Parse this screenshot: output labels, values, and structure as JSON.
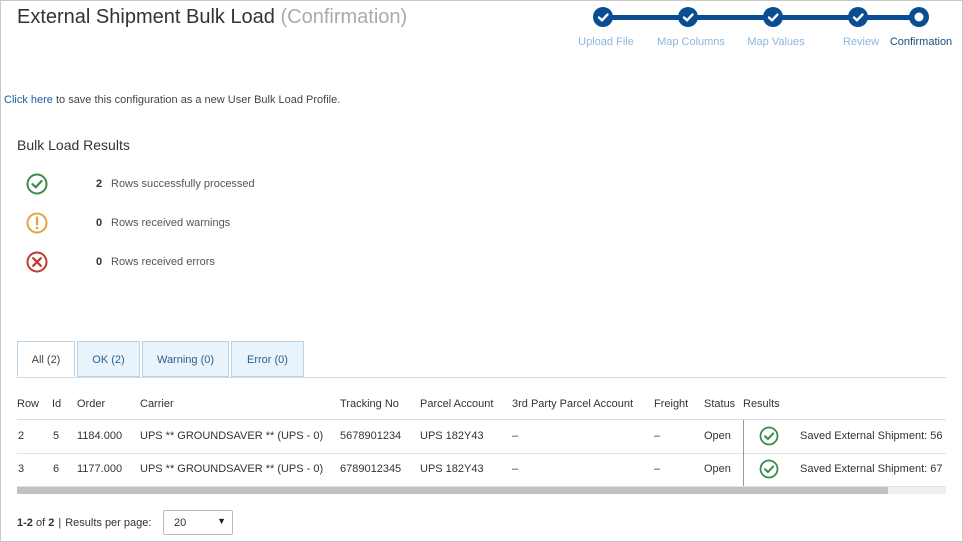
{
  "page": {
    "title": "External Shipment Bulk Load",
    "subtitle": "(Confirmation)"
  },
  "wizard": {
    "steps": [
      {
        "label": "Upload File",
        "state": "done"
      },
      {
        "label": "Map Columns",
        "state": "done"
      },
      {
        "label": "Map Values",
        "state": "done"
      },
      {
        "label": "Review",
        "state": "done"
      },
      {
        "label": "Confirmation",
        "state": "current"
      }
    ]
  },
  "config": {
    "link_text": "Click here",
    "text": " to save this configuration as a new User Bulk Load Profile."
  },
  "results": {
    "title": "Bulk Load Results",
    "items": [
      {
        "icon": "check-circle-icon",
        "count": "2",
        "text": "Rows successfully processed",
        "color": "#3a8a4a"
      },
      {
        "icon": "warning-circle-icon",
        "count": "0",
        "text": "Rows received warnings",
        "color": "#e8a23a"
      },
      {
        "icon": "error-circle-icon",
        "count": "0",
        "text": "Rows received errors",
        "color": "#c0392b"
      }
    ]
  },
  "tabs": [
    {
      "label": "All (2)",
      "active": true
    },
    {
      "label": "OK (2)",
      "active": false
    },
    {
      "label": "Warning (0)",
      "active": false
    },
    {
      "label": "Error (0)",
      "active": false
    }
  ],
  "table": {
    "columns": [
      "Row",
      "Id",
      "Order",
      "Carrier",
      "Tracking No",
      "Parcel Account",
      "3rd Party Parcel Account",
      "Freight",
      "Status",
      "Results"
    ],
    "rows": [
      {
        "row": "2",
        "id": "5",
        "order": "1184.000",
        "carrier": "UPS ** GROUNDSAVER ** (UPS - 0)",
        "tracking": "5678901234",
        "parcel_account": "UPS 182Y43",
        "third_party": "–",
        "freight": "–",
        "status": "Open",
        "result": "Saved External Shipment: 56"
      },
      {
        "row": "3",
        "id": "6",
        "order": "1177.000",
        "carrier": "UPS ** GROUNDSAVER ** (UPS - 0)",
        "tracking": "6789012345",
        "parcel_account": "UPS 182Y43",
        "third_party": "–",
        "freight": "–",
        "status": "Open",
        "result": "Saved External Shipment: 67"
      }
    ]
  },
  "pager": {
    "range": "1-2",
    "of_label": "of",
    "total": "2",
    "per_page_label": "Results per page:",
    "per_page_value": "20"
  }
}
